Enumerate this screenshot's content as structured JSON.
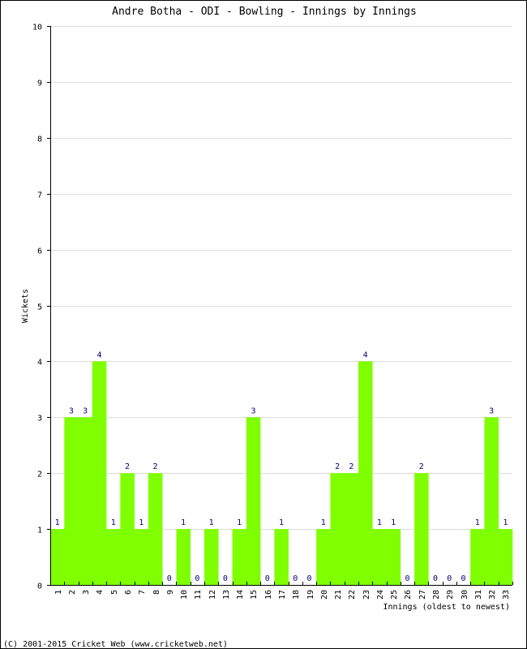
{
  "chart_data": {
    "type": "bar",
    "title": "Andre Botha - ODI - Bowling - Innings by Innings",
    "xlabel": "Innings (oldest to newest)",
    "ylabel": "Wickets",
    "ylim": [
      0,
      10
    ],
    "yticks": [
      0,
      1,
      2,
      3,
      4,
      5,
      6,
      7,
      8,
      9,
      10
    ],
    "grid": true,
    "categories": [
      "1",
      "2",
      "3",
      "4",
      "5",
      "6",
      "7",
      "8",
      "9",
      "10",
      "11",
      "12",
      "13",
      "14",
      "15",
      "16",
      "17",
      "18",
      "19",
      "20",
      "21",
      "22",
      "23",
      "24",
      "25",
      "26",
      "27",
      "28",
      "29",
      "30",
      "31",
      "32",
      "33"
    ],
    "values": [
      1,
      3,
      3,
      4,
      1,
      2,
      1,
      2,
      0,
      1,
      0,
      1,
      0,
      1,
      3,
      0,
      1,
      0,
      0,
      1,
      2,
      2,
      4,
      1,
      1,
      0,
      2,
      0,
      0,
      0,
      1,
      3,
      1
    ],
    "bar_color": "#7FFF00",
    "label_color": "#000080",
    "grid_color": "#DDDDDD"
  },
  "footer": "(C) 2001-2015 Cricket Web (www.cricketweb.net)"
}
